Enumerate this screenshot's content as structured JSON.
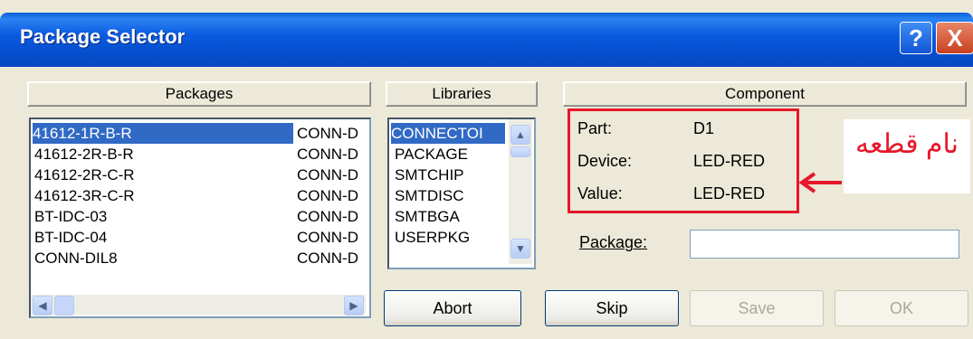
{
  "window": {
    "title": "Package Selector",
    "help_label": "?",
    "close_label": "X"
  },
  "packages": {
    "header": "Packages",
    "rows": [
      {
        "name": "41612-1R-B-R",
        "lib": "CONN-D"
      },
      {
        "name": "41612-2R-B-R",
        "lib": "CONN-D"
      },
      {
        "name": "41612-2R-C-R",
        "lib": "CONN-D"
      },
      {
        "name": "41612-3R-C-R",
        "lib": "CONN-D"
      },
      {
        "name": "BT-IDC-03",
        "lib": "CONN-D"
      },
      {
        "name": "BT-IDC-04",
        "lib": "CONN-D"
      },
      {
        "name": "CONN-DIL8",
        "lib": "CONN-D"
      }
    ]
  },
  "libraries": {
    "header": "Libraries",
    "items": [
      "CONNECTOI",
      "PACKAGE",
      "SMTCHIP",
      "SMTDISC",
      "SMTBGA",
      "USERPKG"
    ]
  },
  "component": {
    "header": "Component",
    "part_label": "Part:",
    "part_value": "D1",
    "device_label": "Device:",
    "device_value": "LED-RED",
    "value_label": "Value:",
    "value_value": "LED-RED",
    "package_label": "Package:",
    "package_value": ""
  },
  "annotation": {
    "text": "نام قطعه",
    "color": "#e6172a"
  },
  "buttons": {
    "abort": "Abort",
    "skip": "Skip",
    "save": "Save",
    "ok": "OK"
  }
}
